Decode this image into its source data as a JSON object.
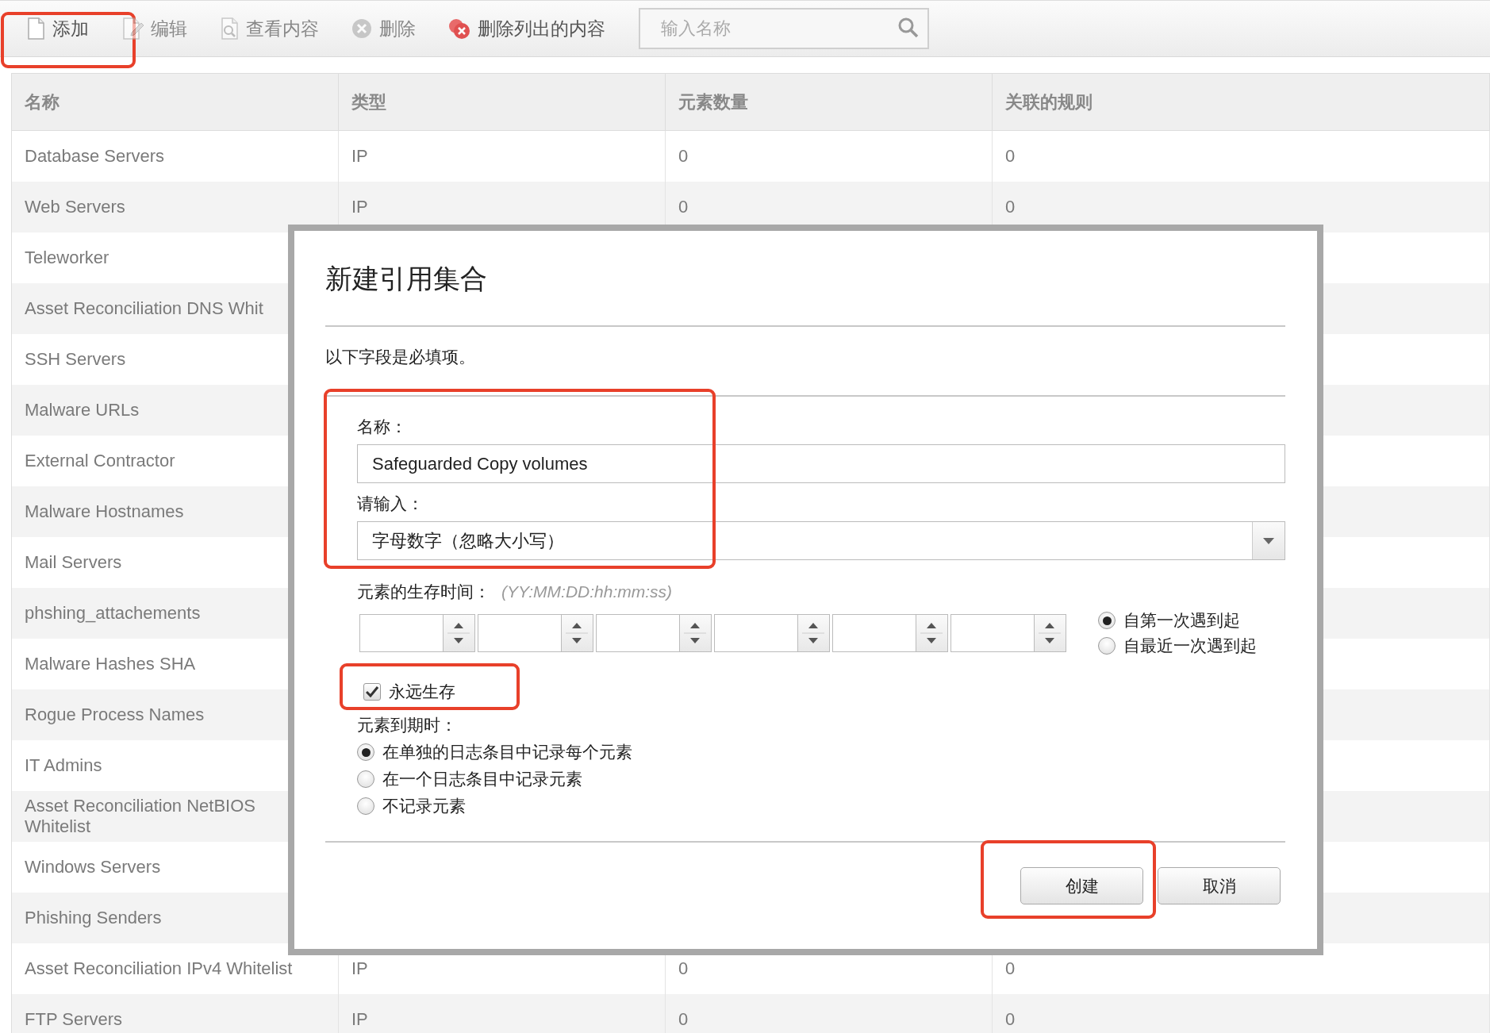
{
  "toolbar": [
    {
      "kind": "add",
      "label": "添加",
      "disabled": false,
      "highlighted": true
    },
    {
      "kind": "edit",
      "label": "编辑",
      "disabled": true,
      "highlighted": false
    },
    {
      "kind": "view",
      "label": "查看内容",
      "disabled": true,
      "highlighted": false
    },
    {
      "kind": "delete",
      "label": "删除",
      "disabled": true,
      "highlighted": false
    },
    {
      "kind": "delete_listed",
      "label": "删除列出的内容",
      "disabled": false,
      "highlighted": false
    }
  ],
  "search": {
    "placeholder": "输入名称"
  },
  "table": {
    "columns": [
      "名称",
      "类型",
      "元素数量",
      "关联的规则"
    ],
    "rows": [
      {
        "name": "Database Servers",
        "type": "IP",
        "count": "0",
        "rules": "0"
      },
      {
        "name": "Web Servers",
        "type": "IP",
        "count": "0",
        "rules": "0"
      },
      {
        "name": "Teleworker"
      },
      {
        "name": "Asset Reconciliation DNS Whit"
      },
      {
        "name": "SSH Servers"
      },
      {
        "name": "Malware URLs"
      },
      {
        "name": "External Contractor"
      },
      {
        "name": "Malware Hostnames"
      },
      {
        "name": "Mail Servers"
      },
      {
        "name": "phshing_attachements"
      },
      {
        "name": "Malware Hashes SHA"
      },
      {
        "name": "Rogue Process Names"
      },
      {
        "name": "IT Admins"
      },
      {
        "name": "Asset Reconciliation NetBIOS Whitelist"
      },
      {
        "name": "Windows Servers"
      },
      {
        "name": "Phishing Senders"
      },
      {
        "name": "Asset Reconciliation IPv4 Whitelist",
        "type": "IP",
        "count": "0",
        "rules": "0"
      },
      {
        "name": "FTP Servers",
        "type": "IP",
        "count": "0",
        "rules": "0"
      }
    ]
  },
  "dialog": {
    "title": "新建引用集合",
    "required_note": "以下字段是必填项。",
    "fields_highlighted": true,
    "fields": [
      {
        "kind": "text",
        "label": "名称：",
        "value": "Safeguarded Copy volumes"
      },
      {
        "kind": "select",
        "label": "请输入：",
        "value": "字母数字（忽略大小写）"
      }
    ],
    "lifetime": {
      "label": "元素的生存时间：",
      "hint": "(YY:MM:DD:hh:mm:ss)",
      "spinners": [
        {
          "kind": "spinner"
        },
        {
          "kind": "spinner"
        },
        {
          "kind": "spinner"
        },
        {
          "kind": "spinner"
        },
        {
          "kind": "spinner"
        },
        {
          "kind": "spinner"
        }
      ],
      "start_options": [
        {
          "label": "自第一次遇到起",
          "selected": true
        },
        {
          "label": "自最近一次遇到起",
          "selected": false
        }
      ]
    },
    "forever": {
      "label": "永远生存",
      "checked": true,
      "highlighted": true
    },
    "expiry": {
      "label": "元素到期时：",
      "options": [
        {
          "label": "在单独的日志条目中记录每个元素",
          "selected": true
        },
        {
          "label": "在一个日志条目中记录元素",
          "selected": false
        },
        {
          "label": "不记录元素",
          "selected": false
        }
      ]
    },
    "buttons": [
      {
        "label": "创建",
        "highlighted": true
      },
      {
        "label": "取消",
        "highlighted": false
      }
    ]
  }
}
